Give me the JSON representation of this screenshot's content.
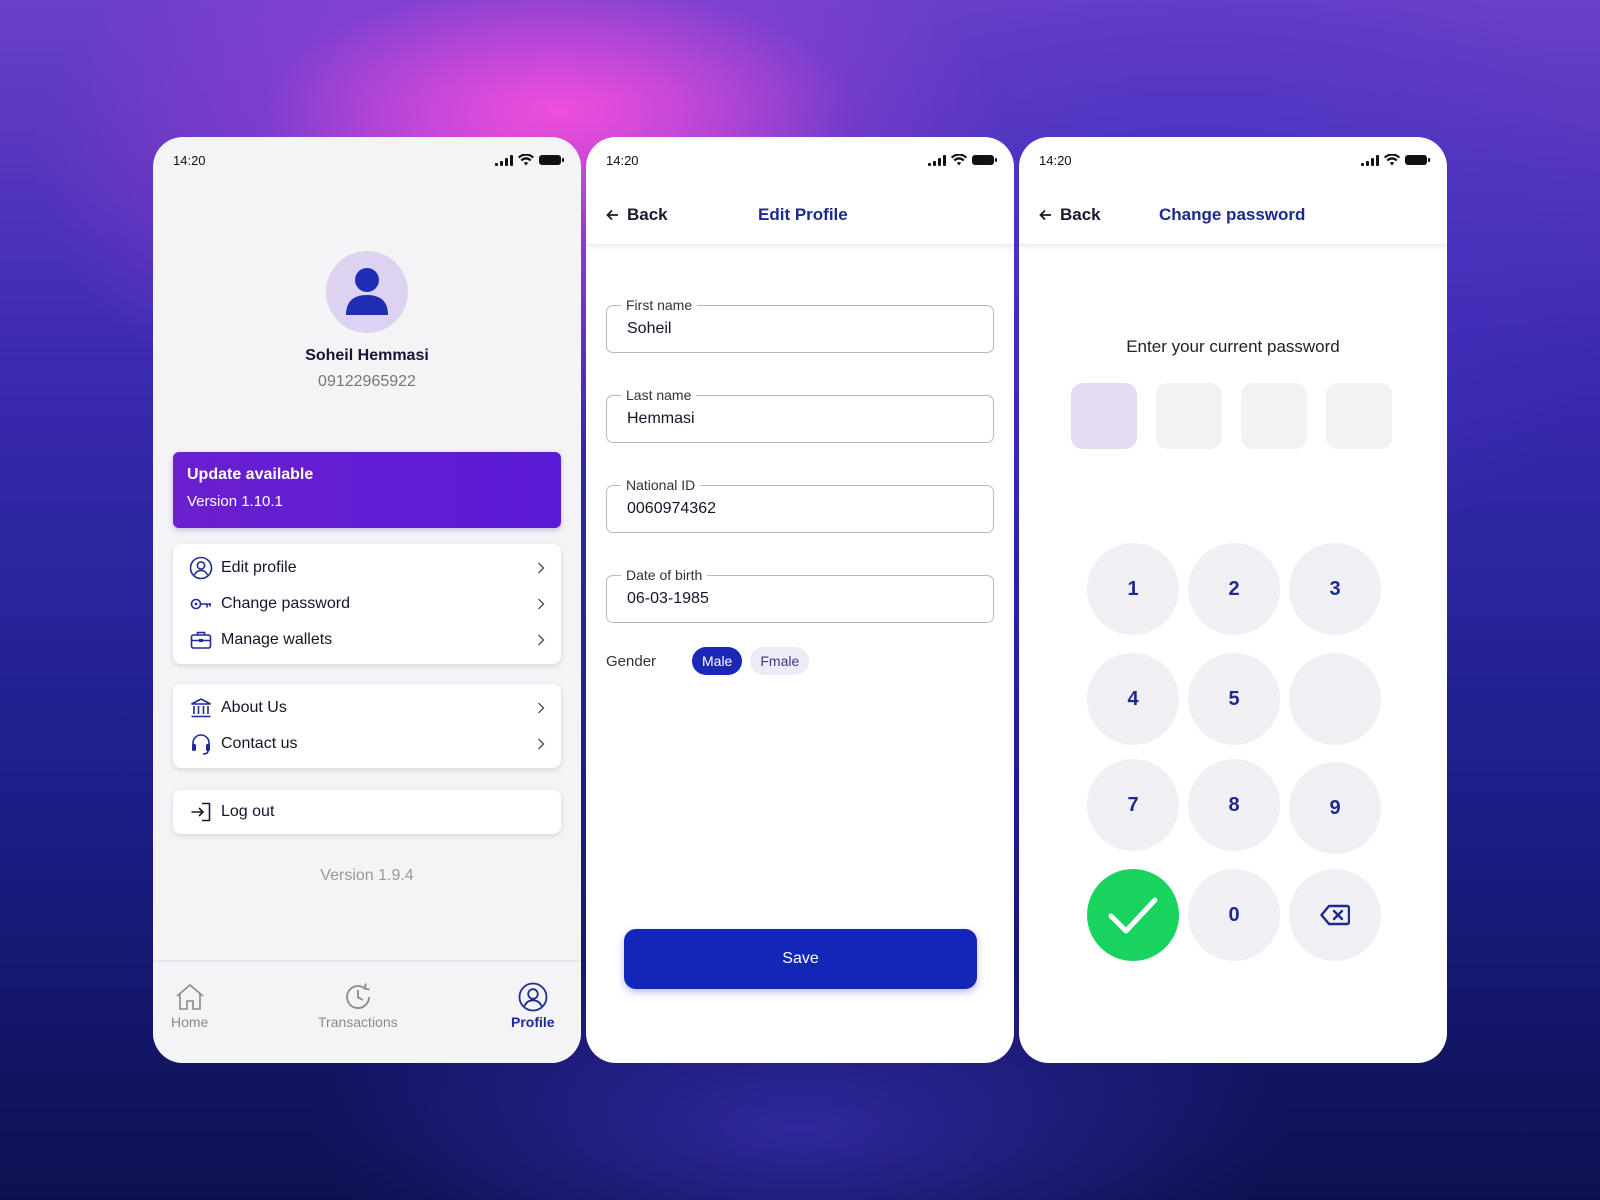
{
  "status_bar": {
    "time": "14:20"
  },
  "profile_screen": {
    "user": {
      "name": "Soheil Hemmasi",
      "phone": "09122965922"
    },
    "update_banner": {
      "title": "Update available",
      "version": "Version 1.10.1"
    },
    "menu_group_1": [
      {
        "label": "Edit profile",
        "icon": "user-circle-icon"
      },
      {
        "label": "Change password",
        "icon": "key-icon"
      },
      {
        "label": "Manage wallets",
        "icon": "wallet-icon"
      }
    ],
    "menu_group_2": [
      {
        "label": "About Us",
        "icon": "bank-icon"
      },
      {
        "label": "Contact us",
        "icon": "headset-icon"
      }
    ],
    "logout": {
      "label": "Log out",
      "icon": "logout-icon"
    },
    "app_version": "Version 1.9.4",
    "tabs": [
      {
        "label": "Home",
        "icon": "home-icon",
        "active": false
      },
      {
        "label": "Transactions",
        "icon": "history-icon",
        "active": false
      },
      {
        "label": "Profile",
        "icon": "user-circle-icon",
        "active": true
      }
    ]
  },
  "edit_profile_screen": {
    "back_label": "Back",
    "title": "Edit Profile",
    "fields": {
      "first_name": {
        "label": "First name",
        "value": "Soheil"
      },
      "last_name": {
        "label": "Last name",
        "value": "Hemmasi"
      },
      "national_id": {
        "label": "National ID",
        "value": "0060974362"
      },
      "date_of_birth": {
        "label": "Date of birth",
        "value": "06-03-1985"
      }
    },
    "gender": {
      "label": "Gender",
      "options": [
        "Male",
        "Fmale"
      ],
      "selected": "Male"
    },
    "save_label": "Save"
  },
  "change_password_screen": {
    "back_label": "Back",
    "title": "Change password",
    "prompt": "Enter your current password",
    "keypad": [
      "1",
      "2",
      "3",
      "4",
      "5",
      "",
      "7",
      "8",
      "9",
      "0"
    ]
  },
  "colors": {
    "primary": "#1426b8",
    "banner": "#6a1fd0",
    "confirm": "#18d45e",
    "pin_active": "#e3dcf3"
  }
}
